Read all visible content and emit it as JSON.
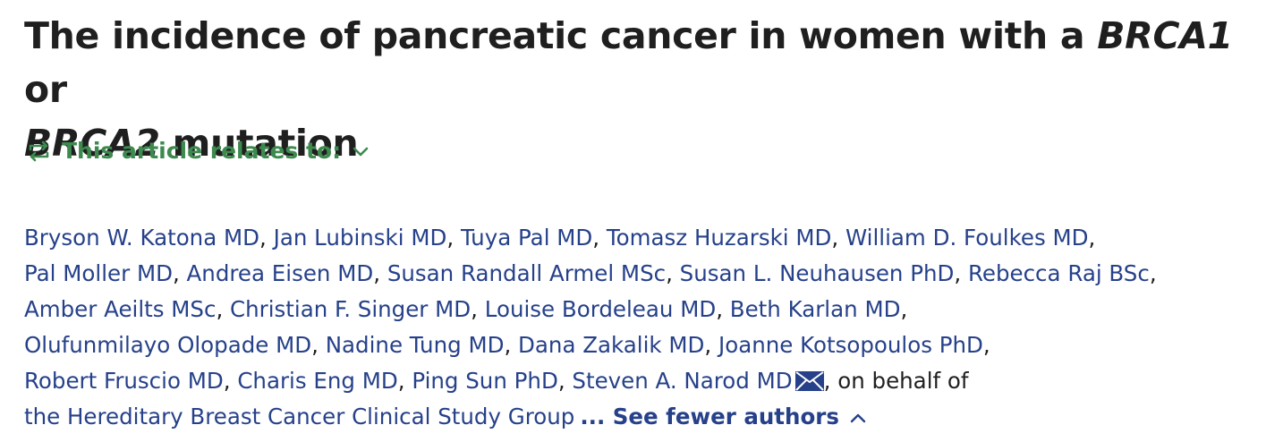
{
  "article": {
    "title_part1": "The incidence of pancreatic cancer in women with a ",
    "gene1": "BRCA1",
    "title_or": " or",
    "gene2": "BRCA2",
    "title_part2": " mutation"
  },
  "relates": {
    "label": "This article relates to:",
    "icon": "swap-arrows-icon",
    "toggle_icon": "chevron-down-icon",
    "color": "#3d8a4f"
  },
  "authors": {
    "list": [
      "Bryson W. Katona MD",
      "Jan Lubinski MD",
      "Tuya Pal MD",
      "Tomasz Huzarski MD",
      "William D. Foulkes MD",
      "Pal Moller MD",
      "Andrea Eisen MD",
      "Susan Randall Armel MSc",
      "Susan L. Neuhausen PhD",
      "Rebecca Raj BSc",
      "Amber Aeilts MSc",
      "Christian F. Singer MD",
      "Louise Bordeleau MD",
      "Beth Karlan MD",
      "Olufunmilayo Olopade MD",
      "Nadine Tung MD",
      "Dana Zakalik MD",
      "Joanne Kotsopoulos PhD",
      "Robert Fruscio MD",
      "Charis Eng MD",
      "Ping Sun PhD",
      "Steven A. Narod MD"
    ],
    "separator": ", ",
    "on_behalf": ", on behalf of",
    "group": "the Hereditary Breast Cancer Clinical Study Group",
    "see_fewer": "... See fewer authors",
    "corresponding_icon": "envelope-icon",
    "link_color": "#26418a"
  }
}
